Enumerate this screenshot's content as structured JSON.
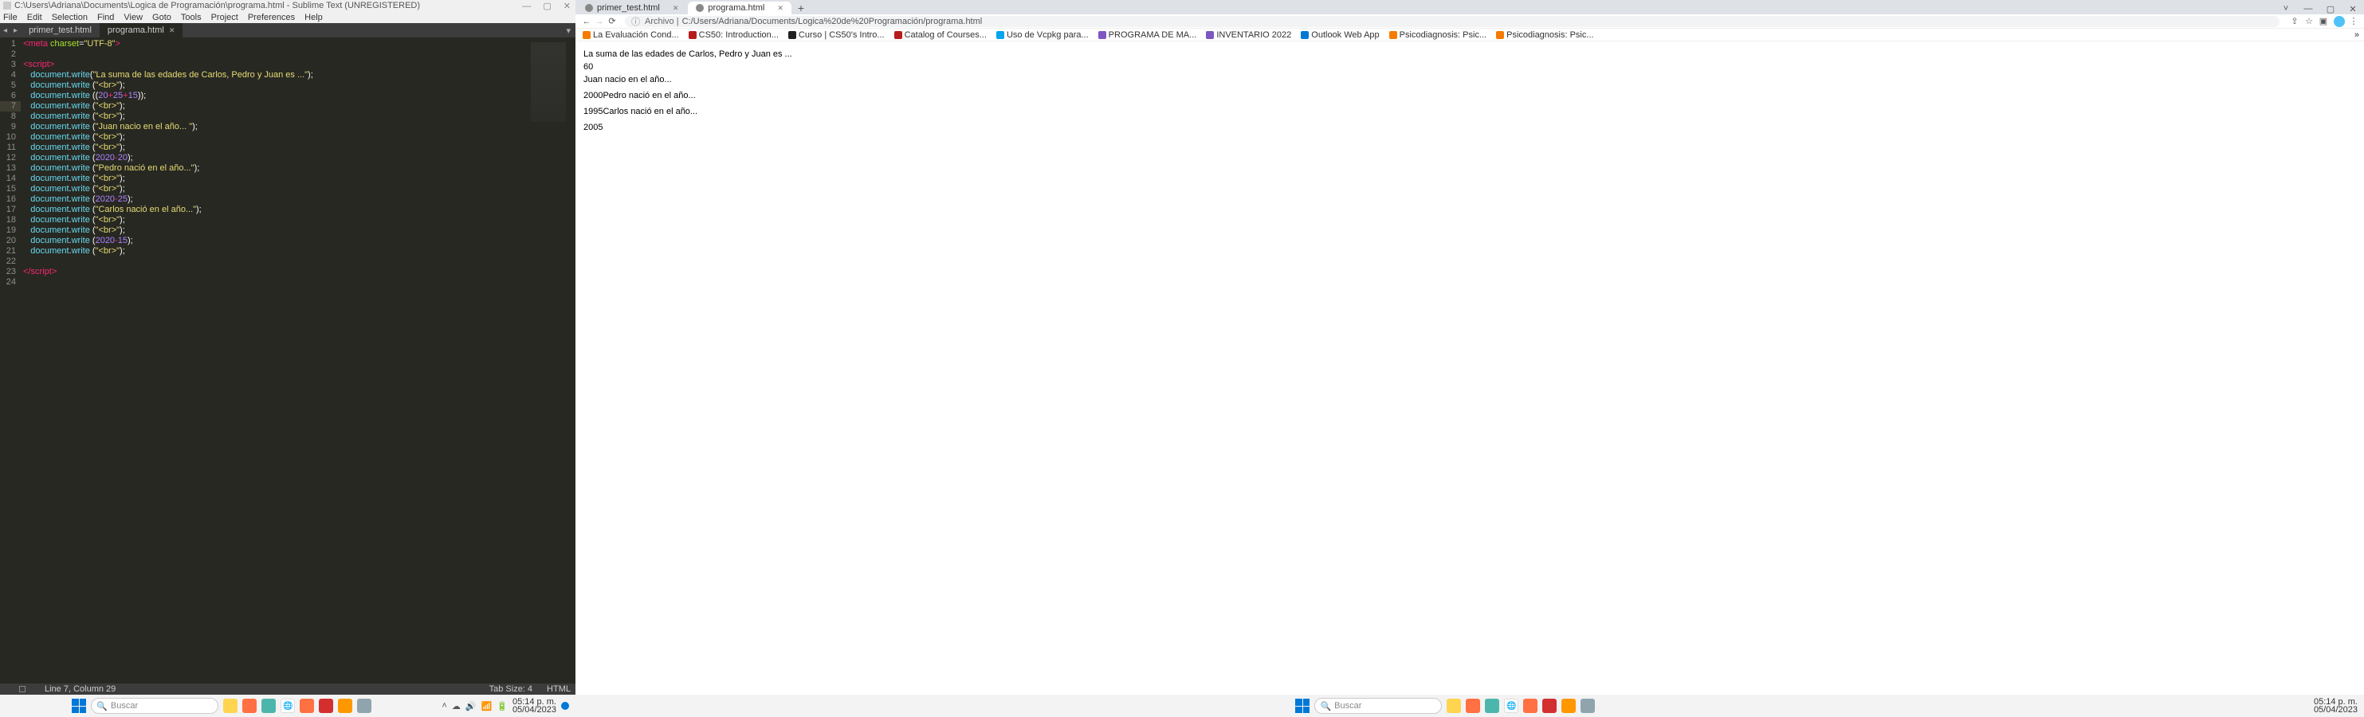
{
  "sublime": {
    "title": "C:\\Users\\Adriana\\Documents\\Logica de Programación\\programa.html - Sublime Text (UNREGISTERED)",
    "menu": [
      "File",
      "Edit",
      "Selection",
      "Find",
      "View",
      "Goto",
      "Tools",
      "Project",
      "Preferences",
      "Help"
    ],
    "tabs": [
      {
        "label": "primer_test.html",
        "active": false
      },
      {
        "label": "programa.html",
        "active": true
      }
    ],
    "line_count": 24,
    "highlighted_line": 7,
    "status_left": "Line 7, Column 29",
    "status_tab": "Tab Size: 4",
    "status_lang": "HTML",
    "code": {
      "l1": {
        "p1": "<",
        "p2": "meta ",
        "p3": "charset",
        "p4": "=",
        "p5": "\"UTF-8\"",
        "p6": ">"
      },
      "l3": {
        "p1": "<",
        "p2": "script",
        "p3": ">"
      },
      "l4": {
        "obj": "document",
        "dot": ".",
        "fn": "write",
        "p1": "(",
        "str": "\"La suma de las edades de Carlos, Pedro y Juan es ...\"",
        "p2": ");"
      },
      "l5": {
        "obj": "document",
        "dot": ".",
        "fn": "write",
        "p1": " (",
        "str": "\"<br>\"",
        "p2": ");"
      },
      "l6": {
        "obj": "document",
        "dot": ".",
        "fn": "write",
        "p1": " ((",
        "n1": "20",
        "o1": "+",
        "n2": "25",
        "o2": "+",
        "n3": "15",
        "p2": "));"
      },
      "l7": {
        "obj": "document",
        "dot": ".",
        "fn": "write",
        "p1": " (",
        "str": "\"<br>\"",
        "p2": ");"
      },
      "l8": {
        "obj": "document",
        "dot": ".",
        "fn": "write",
        "p1": " (",
        "str": "\"<br>\"",
        "p2": ");"
      },
      "l9": {
        "obj": "document",
        "dot": ".",
        "fn": "write",
        "p1": " (",
        "str": "\"Juan nacio en el año... \"",
        "p2": ");"
      },
      "l10": {
        "obj": "document",
        "dot": ".",
        "fn": "write",
        "p1": " (",
        "str": "\"<br>\"",
        "p2": ");"
      },
      "l11": {
        "obj": "document",
        "dot": ".",
        "fn": "write",
        "p1": " (",
        "str": "\"<br>\"",
        "p2": ");"
      },
      "l12": {
        "obj": "document",
        "dot": ".",
        "fn": "write",
        "p1": " (",
        "n1": "2020",
        "o1": "-",
        "n2": "20",
        "p2": ");"
      },
      "l13": {
        "obj": "document",
        "dot": ".",
        "fn": "write",
        "p1": " (",
        "str": "\"Pedro nació en el año...\"",
        "p2": ");"
      },
      "l14": {
        "obj": "document",
        "dot": ".",
        "fn": "write",
        "p1": " (",
        "str": "\"<br>\"",
        "p2": ");"
      },
      "l15": {
        "obj": "document",
        "dot": ".",
        "fn": "write",
        "p1": " (",
        "str": "\"<br>\"",
        "p2": ");"
      },
      "l16": {
        "obj": "document",
        "dot": ".",
        "fn": "write",
        "p1": " (",
        "n1": "2020",
        "o1": "-",
        "n2": "25",
        "p2": ");"
      },
      "l17": {
        "obj": "document",
        "dot": ".",
        "fn": "write",
        "p1": " (",
        "str": "\"Carlos nació en el año...\"",
        "p2": ");"
      },
      "l18": {
        "obj": "document",
        "dot": ".",
        "fn": "write",
        "p1": " (",
        "str": "\"<br>\"",
        "p2": ");"
      },
      "l19": {
        "obj": "document",
        "dot": ".",
        "fn": "write",
        "p1": " (",
        "str": "\"<br>\"",
        "p2": ");"
      },
      "l20": {
        "obj": "document",
        "dot": ".",
        "fn": "write",
        "p1": " (",
        "n1": "2020",
        "o1": "-",
        "n2": "15",
        "p2": ");"
      },
      "l21": {
        "obj": "document",
        "dot": ".",
        "fn": "write",
        "p1": " (",
        "str": "\"<br>\"",
        "p2": ");"
      },
      "l23": {
        "p1": "</",
        "p2": "script",
        "p3": ">"
      }
    }
  },
  "taskbar_left": {
    "search_placeholder": "Buscar",
    "time": "05:14 p. m.",
    "date": "05/04/2023"
  },
  "chrome": {
    "tabs": [
      {
        "label": "primer_test.html",
        "active": false
      },
      {
        "label": "programa.html",
        "active": true
      }
    ],
    "newtab": "+",
    "url_scheme": "Archivo |",
    "url_path": "C:/Users/Adriana/Documents/Logica%20de%20Programación/programa.html",
    "bookmarks": [
      {
        "label": "La Evaluación Cond...",
        "color": "#f57c00"
      },
      {
        "label": "CS50: Introduction...",
        "color": "#b71c1c"
      },
      {
        "label": "Curso | CS50's Intro...",
        "color": "#212121"
      },
      {
        "label": "Catalog of Courses...",
        "color": "#b71c1c"
      },
      {
        "label": "Uso de Vcpkg para...",
        "color": "#00a4ef"
      },
      {
        "label": "PROGRAMA DE MA...",
        "color": "#7e57c2"
      },
      {
        "label": "INVENTARIO 2022",
        "color": "#7e57c2"
      },
      {
        "label": "Outlook Web App",
        "color": "#0078d4"
      },
      {
        "label": "Psicodiagnosis: Psic...",
        "color": "#f57c00"
      },
      {
        "label": "Psicodiagnosis: Psic...",
        "color": "#f57c00"
      }
    ],
    "bm_more": "»"
  },
  "page_output": {
    "l1": "La suma de las edades de Carlos, Pedro y Juan es ...",
    "l2": "60",
    "l3": "Juan nacio en el año...",
    "l4": "2000Pedro nació en el año...",
    "l5": "1995Carlos nació en el año...",
    "l6": "2005"
  },
  "taskbar_right": {
    "search_placeholder": "Buscar",
    "time": "05:14 p. m.",
    "date": "05/04/2023"
  }
}
